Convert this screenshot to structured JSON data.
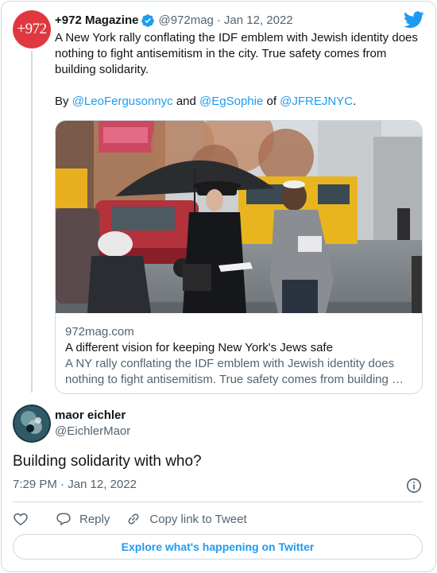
{
  "parent_tweet": {
    "avatar_text": "+972",
    "display_name": "+972 Magazine",
    "handle": "@972mag",
    "separator": "·",
    "date": "Jan 12, 2022",
    "text_lines": [
      "A New York rally conflating the IDF emblem with Jewish identity does",
      "nothing to fight antisemitism in the city. True safety comes from",
      "building solidarity."
    ],
    "byline": {
      "by": "By",
      "author1": "@LeoFergusonnyc",
      "and": "and",
      "author2": "@EgSophie",
      "of": "of",
      "org": "@JFREJNYC",
      "period": "."
    },
    "link_card": {
      "domain": "972mag.com",
      "title": "A different vision for keeping New York's Jews safe",
      "desc_line1": "A NY rally conflating the IDF emblem with Jewish identity does",
      "desc_line2": "nothing to fight antisemitism. True safety comes from building …"
    }
  },
  "reply_tweet": {
    "display_name": "maor eichler",
    "handle": "@EichlerMaor",
    "text": "Building solidarity with who?",
    "timestamp": "7:29 PM · Jan 12, 2022"
  },
  "actions": {
    "reply_label": "Reply",
    "copy_label": "Copy link to Tweet"
  },
  "explore_label": "Explore what's happening on Twitter",
  "colors": {
    "accent": "#1d9bf0",
    "avatar_red": "#e0383e",
    "muted": "#536471",
    "border": "#cfd9de"
  },
  "icons": [
    "verified-badge-icon",
    "twitter-bird-icon",
    "info-icon",
    "heart-icon",
    "reply-icon",
    "copy-link-icon"
  ]
}
